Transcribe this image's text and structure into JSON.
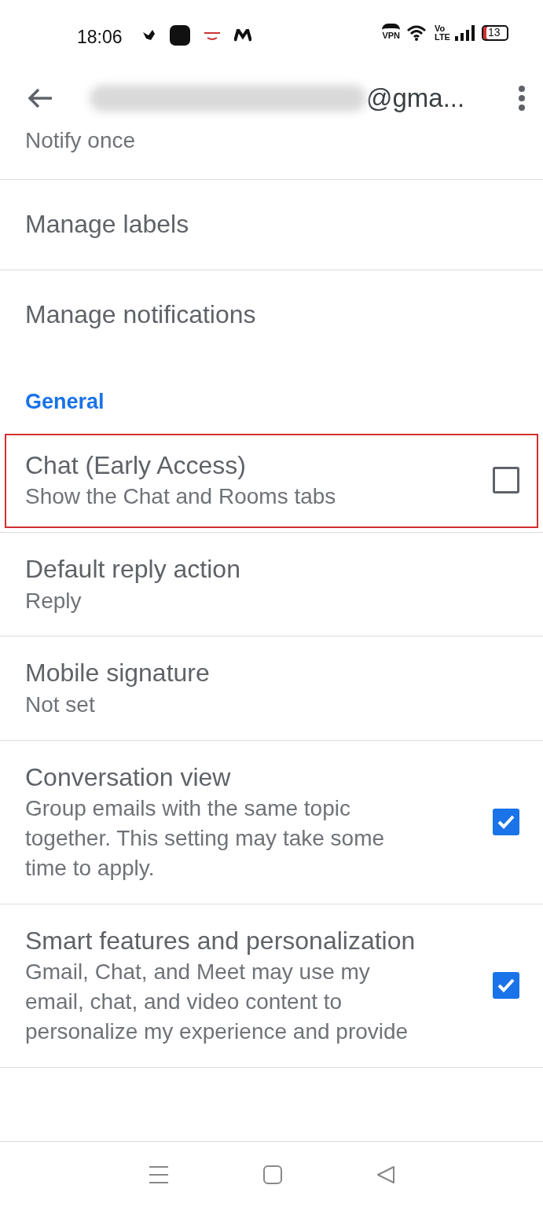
{
  "status_bar": {
    "time": "18:06",
    "vpn_label": "VPN",
    "volte_label": "Vo LTE",
    "battery": "13"
  },
  "header": {
    "title": "@gma..."
  },
  "settings": [
    {
      "kind": "partial",
      "title": "Notify once"
    },
    {
      "kind": "item",
      "title": "Manage labels"
    },
    {
      "kind": "item",
      "title": "Manage notifications",
      "divider": false
    },
    {
      "kind": "section",
      "title": "General"
    },
    {
      "kind": "checkbox",
      "title": "Chat (Early Access)",
      "subtitle": "Show the Chat and Rooms tabs",
      "checked": false,
      "highlighted": true
    },
    {
      "kind": "item",
      "title": "Default reply action",
      "subtitle": "Reply"
    },
    {
      "kind": "item",
      "title": "Mobile signature",
      "subtitle": "Not set"
    },
    {
      "kind": "checkbox",
      "title": "Conversation view",
      "subtitle": "Group emails with the same topic together. This setting may take some time to apply.",
      "checked": true,
      "highlighted": false
    },
    {
      "kind": "checkbox",
      "title": "Smart features and personalization",
      "subtitle": "Gmail, Chat, and Meet may use my email, chat, and video content to personalize my experience and provide",
      "checked": true,
      "highlighted": false
    }
  ]
}
